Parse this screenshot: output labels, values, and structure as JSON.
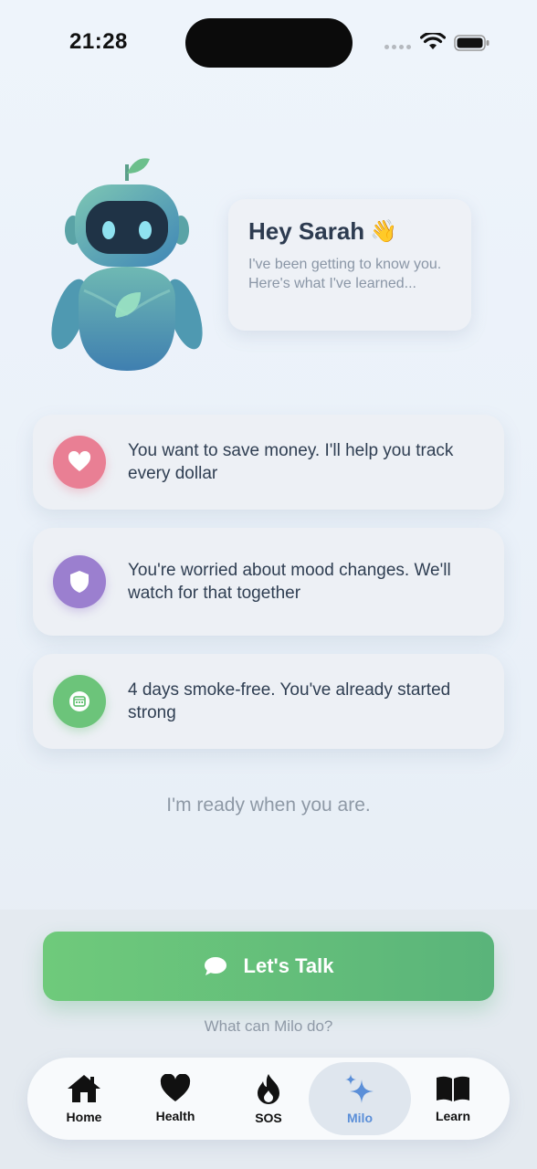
{
  "status_bar": {
    "time": "21:28"
  },
  "greeting": {
    "title": "Hey Sarah",
    "emoji": "👋",
    "subtitle": "I've been getting to know you. Here's what I've learned..."
  },
  "insights": [
    {
      "icon": "heart-icon",
      "color": "#e97f94",
      "text": "You want to save money. I'll help you track every dollar"
    },
    {
      "icon": "shield-icon",
      "color": "#9b7fcf",
      "text": "You're worried about mood changes. We'll watch for that together"
    },
    {
      "icon": "calendar-icon",
      "color": "#6cc47a",
      "text": "4 days smoke-free. You've already started strong"
    }
  ],
  "ready_text": "I'm ready when you are.",
  "cta": {
    "label": "Let's Talk",
    "icon": "chat-bubble-icon"
  },
  "secondary_link": "What can Milo do?",
  "tabs": [
    {
      "label": "Home",
      "icon": "home-icon"
    },
    {
      "label": "Health",
      "icon": "heart-icon"
    },
    {
      "label": "SOS",
      "icon": "flame-icon"
    },
    {
      "label": "Milo",
      "icon": "sparkles-icon",
      "active": true
    },
    {
      "label": "Learn",
      "icon": "book-icon"
    }
  ],
  "colors": {
    "accent": "#5b8fd8",
    "cta_green": "#6fca7b"
  }
}
